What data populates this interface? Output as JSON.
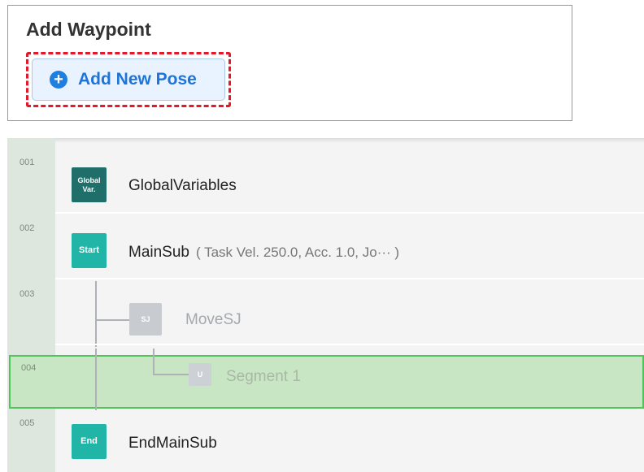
{
  "waypoint_panel": {
    "title": "Add Waypoint",
    "add_pose_icon": "plus-circle-icon",
    "add_pose_glyph": "+",
    "add_pose_label": "Add New Pose",
    "colors": {
      "accent": "#1f7fe0",
      "focus_outline": "#e3192b"
    }
  },
  "tree": {
    "rows": [
      {
        "number": "001",
        "badge": "Global Var.",
        "badge_line1": "Global",
        "badge_line2": "Var.",
        "label": "GlobalVariables",
        "note": ""
      },
      {
        "number": "002",
        "badge": "Start",
        "label": "MainSub",
        "note": "( Task Vel. 250.0, Acc. 1.0, Jo··· )"
      },
      {
        "number": "003",
        "badge": "SJ",
        "label": "MoveSJ",
        "note": ""
      },
      {
        "number": "004",
        "badge": "U",
        "label": "Segment 1",
        "note": "",
        "selected": true
      },
      {
        "number": "005",
        "badge": "End",
        "label": "EndMainSub",
        "note": ""
      }
    ],
    "colors": {
      "selected_fill": "#c9e6c4",
      "selected_border": "#52c35a",
      "teal": "#20b5a6",
      "dark_teal": "#1f6e6a"
    }
  }
}
